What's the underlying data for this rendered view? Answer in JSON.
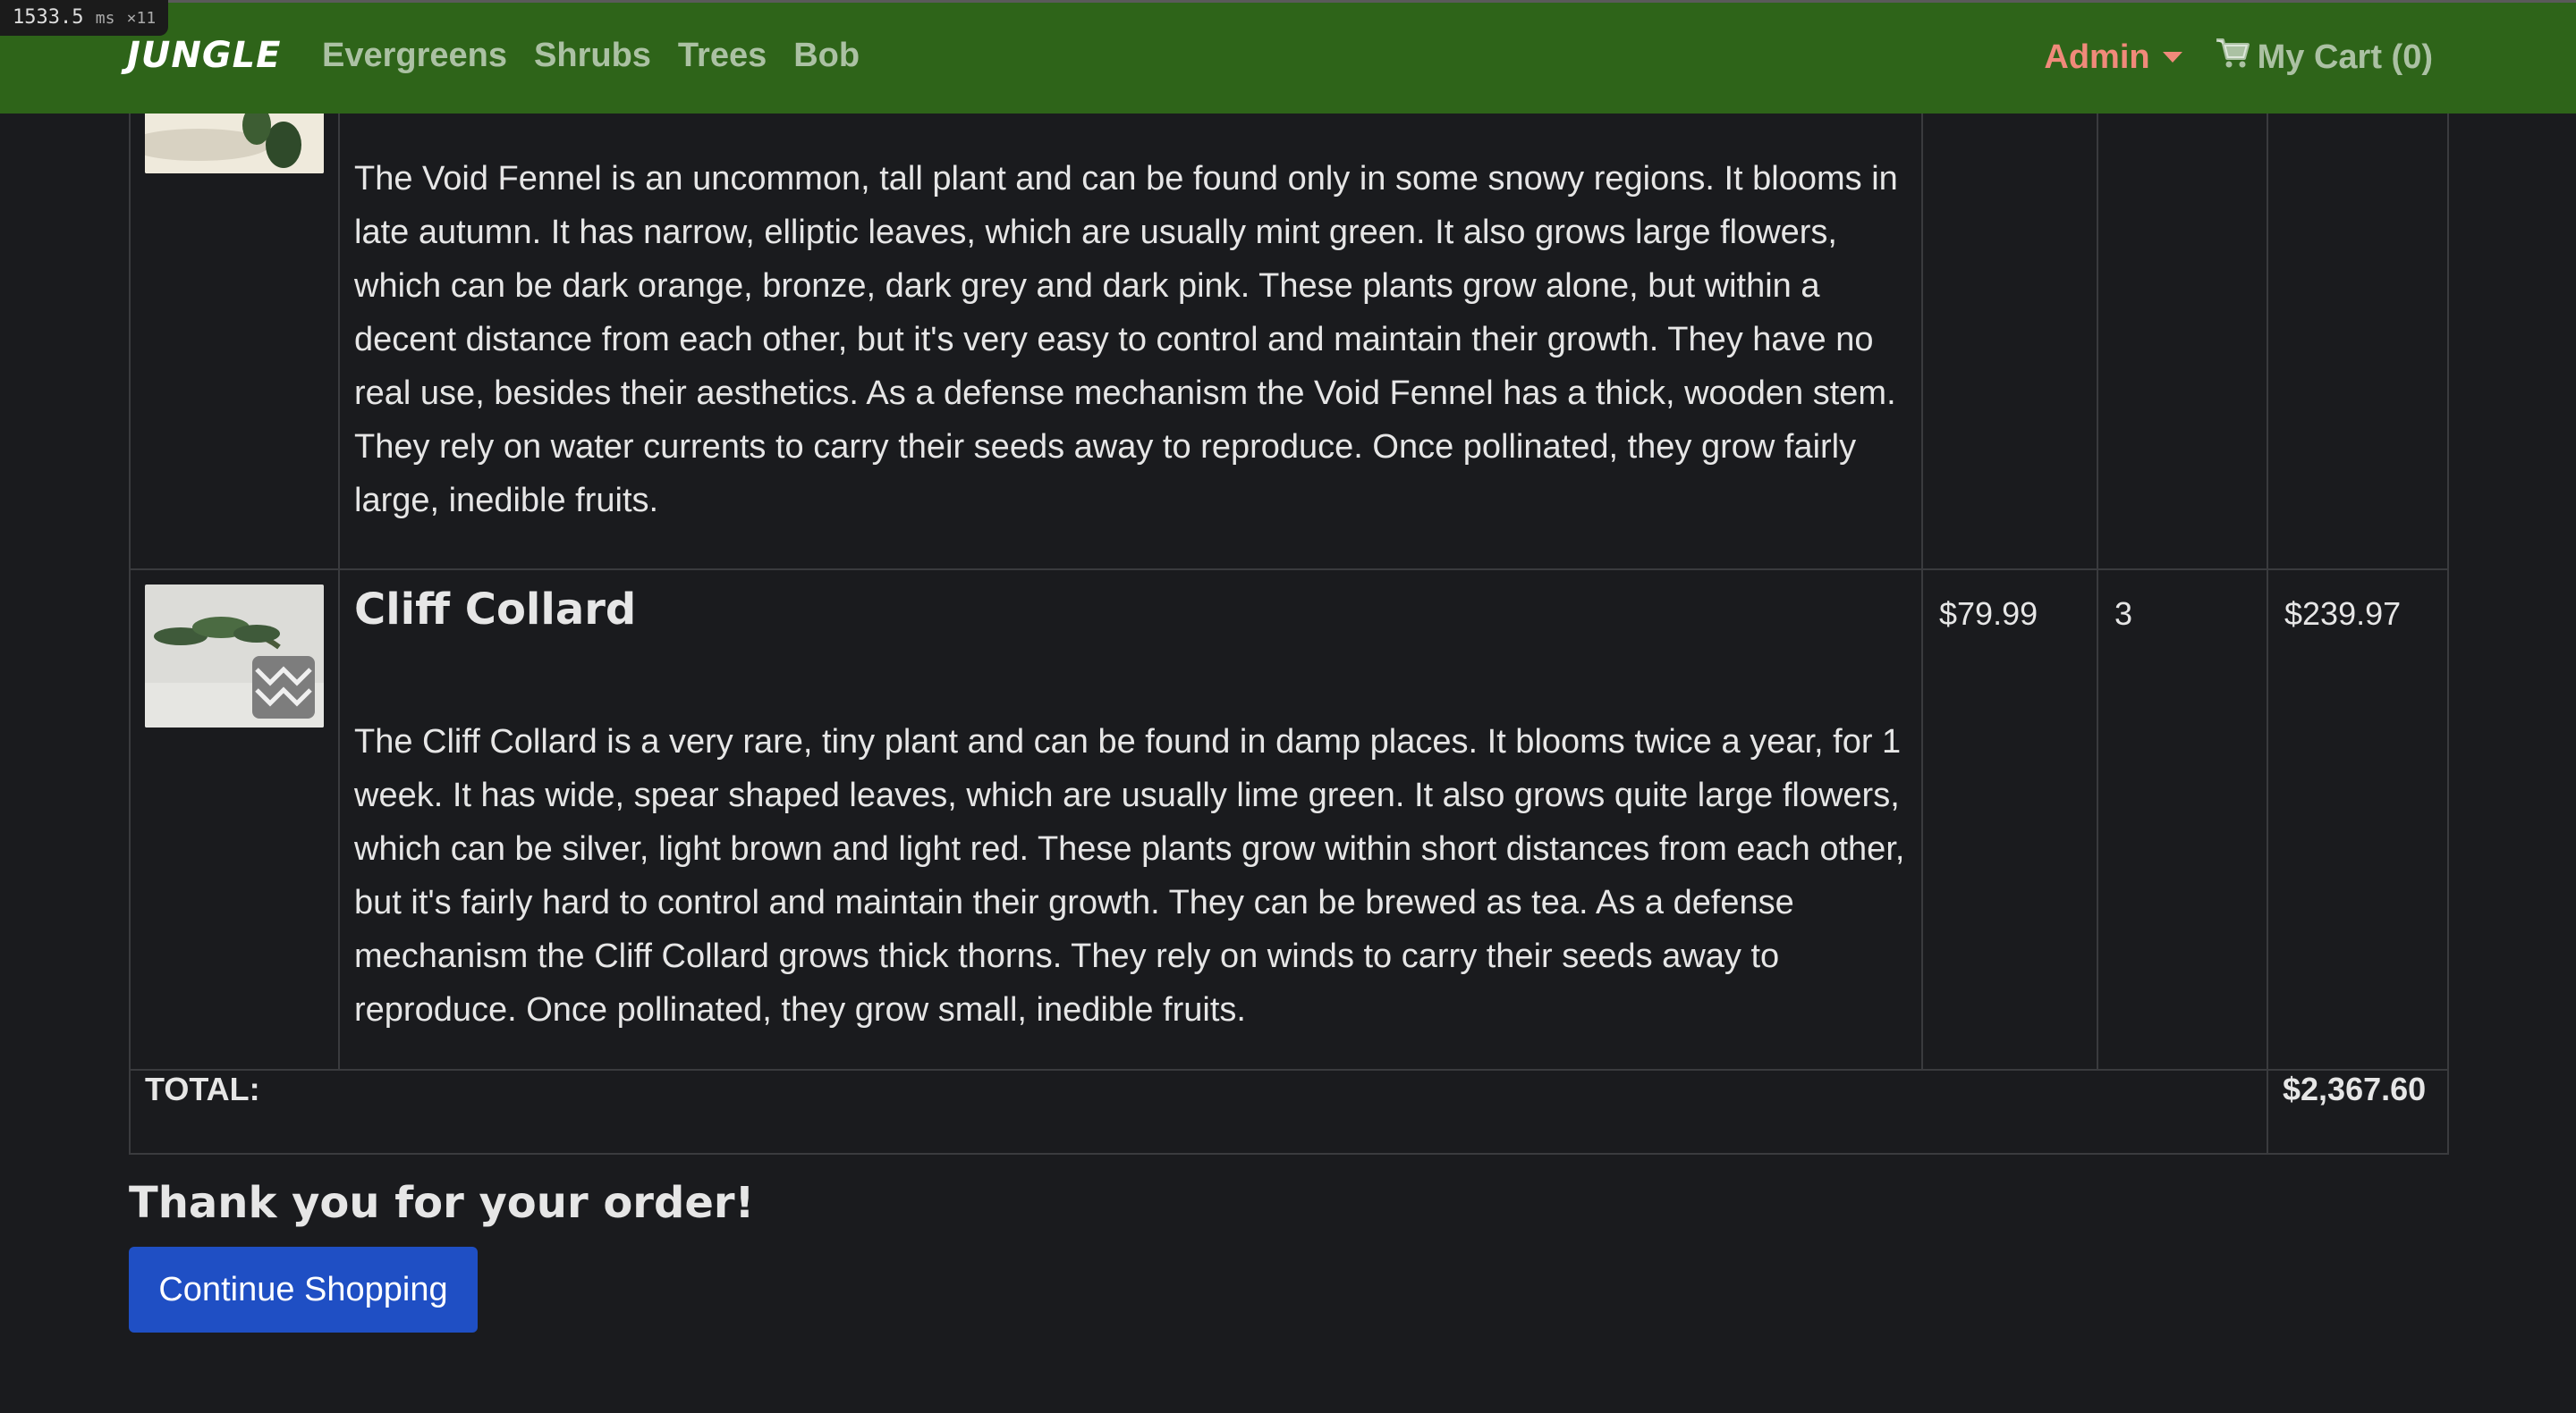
{
  "perf": {
    "value": "1533.5",
    "unit": "ms",
    "count": "×11"
  },
  "navbar": {
    "brand": "JUNGLE",
    "links": [
      "Evergreens",
      "Shrubs",
      "Trees",
      "Bob"
    ],
    "admin_label": "Admin",
    "cart_label": "My Cart (0)",
    "bg_color": "#2e6419",
    "admin_color": "#f08a7a"
  },
  "order": {
    "items": [
      {
        "name": "",
        "description": "The Void Fennel is an uncommon, tall plant and can be found only in some snowy regions. It blooms in late autumn. It has narrow, elliptic leaves, which are usually mint green. It also grows large flowers, which can be dark orange, bronze, dark grey and dark pink. These plants grow alone, but within a decent distance from each other, but it's very easy to control and maintain their growth. They have no real use, besides their aesthetics. As a defense mechanism the Void Fennel has a thick, wooden stem. They rely on water currents to carry their seeds away to reproduce. Once pollinated, they grow fairly large, inedible fruits.",
        "price": "",
        "quantity": "",
        "subtotal": ""
      },
      {
        "name": "Cliff Collard",
        "description": "The Cliff Collard is a very rare, tiny plant and can be found in damp places. It blooms twice a year, for 1 week. It has wide, spear shaped leaves, which are usually lime green. It also grows quite large flowers, which can be silver, light brown and light red. These plants grow within short distances from each other, but it's fairly hard to control and maintain their growth. They can be brewed as tea. As a defense mechanism the Cliff Collard grows thick thorns. They rely on winds to carry their seeds away to reproduce. Once pollinated, they grow small, inedible fruits.",
        "price": "$79.99",
        "quantity": "3",
        "subtotal": "$239.97"
      }
    ],
    "total_label": "TOTAL:",
    "total_value": "$2,367.60"
  },
  "thanks": "Thank you for your order!",
  "continue_label": "Continue Shopping",
  "button_color": "#1f4fc4"
}
